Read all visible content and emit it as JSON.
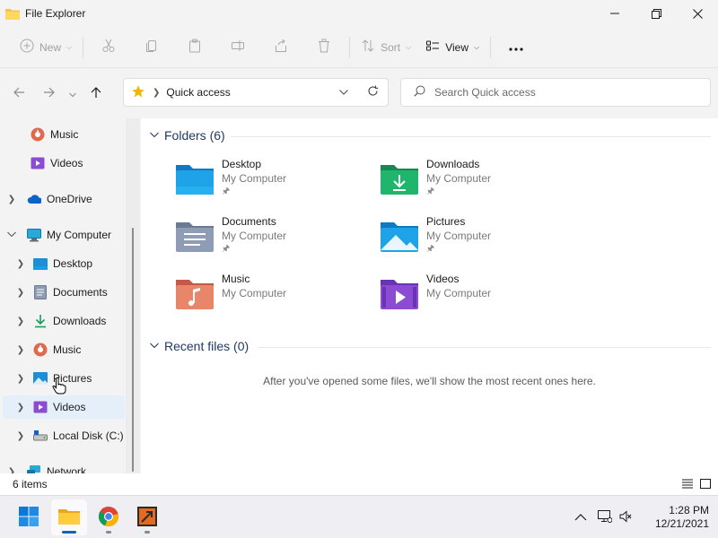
{
  "window": {
    "title": "File Explorer",
    "minimize_icon": "minimize-icon",
    "maximize_icon": "restore-icon",
    "close_icon": "close-icon"
  },
  "commandbar": {
    "new_label": "New",
    "sort_label": "Sort",
    "view_label": "View",
    "icons": [
      "new-icon",
      "cut-icon",
      "copy-icon",
      "paste-icon",
      "rename-icon",
      "share-icon",
      "delete-icon",
      "sort-icon",
      "view-icon",
      "more-icon"
    ]
  },
  "navigation": {
    "address_crumb": "Quick access",
    "search_placeholder": "Search Quick access"
  },
  "sidebar": {
    "items": [
      {
        "label": "Music",
        "icon": "music-icon"
      },
      {
        "label": "Videos",
        "icon": "videos-icon"
      },
      {
        "label": "OneDrive",
        "icon": "cloud-icon"
      },
      {
        "label": "My Computer",
        "icon": "computer-icon"
      },
      {
        "label": "Desktop",
        "icon": "desktop-icon"
      },
      {
        "label": "Documents",
        "icon": "documents-icon"
      },
      {
        "label": "Downloads",
        "icon": "downloads-icon"
      },
      {
        "label": "Music",
        "icon": "music-icon"
      },
      {
        "label": "Pictures",
        "icon": "pictures-icon"
      },
      {
        "label": "Videos",
        "icon": "videos-icon"
      },
      {
        "label": "Local Disk (C:)",
        "icon": "drive-icon"
      },
      {
        "label": "Network",
        "icon": "network-icon"
      }
    ],
    "selected": "Videos"
  },
  "content": {
    "folders_heading": "Folders (6)",
    "recent_heading": "Recent files (0)",
    "empty_message": "After you've opened some files, we'll show the most recent ones here.",
    "folders": [
      {
        "name": "Desktop",
        "location": "My Computer",
        "pinned": true
      },
      {
        "name": "Downloads",
        "location": "My Computer",
        "pinned": true
      },
      {
        "name": "Documents",
        "location": "My Computer",
        "pinned": true
      },
      {
        "name": "Pictures",
        "location": "My Computer",
        "pinned": true
      },
      {
        "name": "Music",
        "location": "My Computer",
        "pinned": false
      },
      {
        "name": "Videos",
        "location": "My Computer",
        "pinned": false
      }
    ]
  },
  "status": {
    "item_count": "6 items"
  },
  "taskbar": {
    "time": "1:28 PM",
    "date": "12/21/2021",
    "apps": [
      "start-icon",
      "file-explorer-icon",
      "chrome-icon",
      "app-icon"
    ]
  },
  "colors": {
    "accent": "#0067c0",
    "selection": "#e5effa",
    "group_heading": "#1f3a63"
  }
}
